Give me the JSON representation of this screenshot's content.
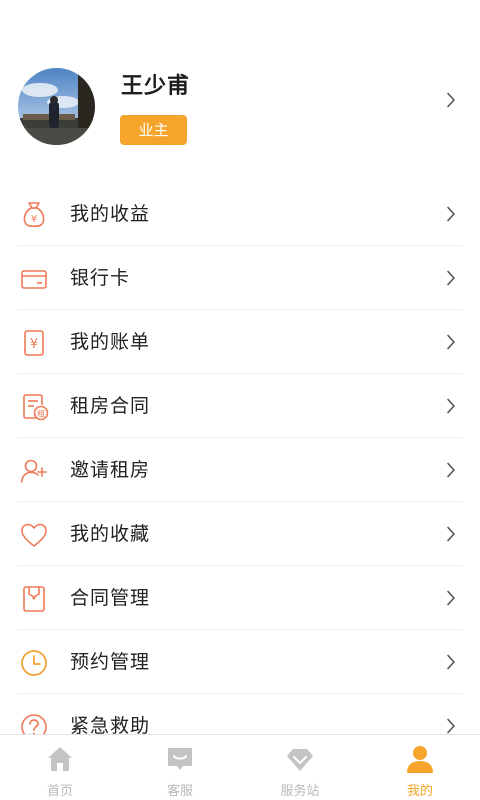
{
  "profile": {
    "name": "王少甫",
    "role": "业主"
  },
  "menu": [
    {
      "label": "我的收益",
      "icon": "money-bag-icon"
    },
    {
      "label": "银行卡",
      "icon": "bank-card-icon"
    },
    {
      "label": "我的账单",
      "icon": "bill-icon"
    },
    {
      "label": "租房合同",
      "icon": "rental-contract-icon"
    },
    {
      "label": "邀请租房",
      "icon": "invite-user-icon"
    },
    {
      "label": "我的收藏",
      "icon": "heart-icon"
    },
    {
      "label": "合同管理",
      "icon": "contract-management-icon"
    },
    {
      "label": "预约管理",
      "icon": "clock-icon"
    },
    {
      "label": "紧急救助",
      "icon": "help-icon"
    }
  ],
  "tabbar": {
    "tabs": [
      {
        "label": "首页",
        "icon": "home-icon",
        "active": false
      },
      {
        "label": "客服",
        "icon": "message-icon",
        "active": false
      },
      {
        "label": "服务站",
        "icon": "service-station-icon",
        "active": false
      },
      {
        "label": "我的",
        "icon": "user-icon",
        "active": true
      }
    ]
  },
  "colors": {
    "accent": "#f5a52b",
    "icon": "#ee7a57",
    "inactive_tab": "#b9b9b9"
  }
}
